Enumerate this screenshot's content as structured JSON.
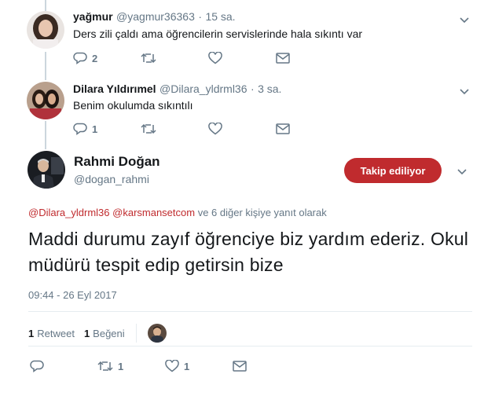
{
  "replies": [
    {
      "name": "yağmur",
      "handle": "@yagmur36363",
      "time_sep": "·",
      "time": "15 sa.",
      "text": "Ders zili çaldı ama öğrencilerin servislerinde hala sıkıntı var",
      "reply_count": "2",
      "retweet_count": "",
      "like_count": ""
    },
    {
      "name": "Dilara Yıldırımel",
      "handle": "@Dilara_yldrml36",
      "time_sep": "·",
      "time": "3 sa.",
      "text": "Benim okulumda sıkıntılı",
      "reply_count": "1",
      "retweet_count": "",
      "like_count": ""
    }
  ],
  "main_tweet": {
    "name": "Rahmi Doğan",
    "handle": "@dogan_rahmi",
    "follow_label": "Takip ediliyor",
    "reply_to_mention1": "@Dilara_yldrml36",
    "reply_to_mention2": "@karsmansetcom",
    "reply_to_suffix": "ve 6 diğer kişiye yanıt olarak",
    "text": "Maddi durumu zayıf öğrenciye biz yardım ederiz. Okul müdürü tespit edip getirsin bize",
    "timestamp": "09:44 - 26 Eyl 2017",
    "retweets_count": "1",
    "retweets_label": "Retweet",
    "likes_count": "1",
    "likes_label": "Beğeni",
    "reply_count": "",
    "retweet_count": "1",
    "like_count": "1"
  },
  "colors": {
    "accent": "#c02b2e",
    "muted": "#657786",
    "text": "#14171a",
    "thread_line": "#ccd6dd"
  },
  "icons": [
    "reply-icon",
    "retweet-icon",
    "heart-icon",
    "message-icon",
    "chevron-down-icon"
  ]
}
